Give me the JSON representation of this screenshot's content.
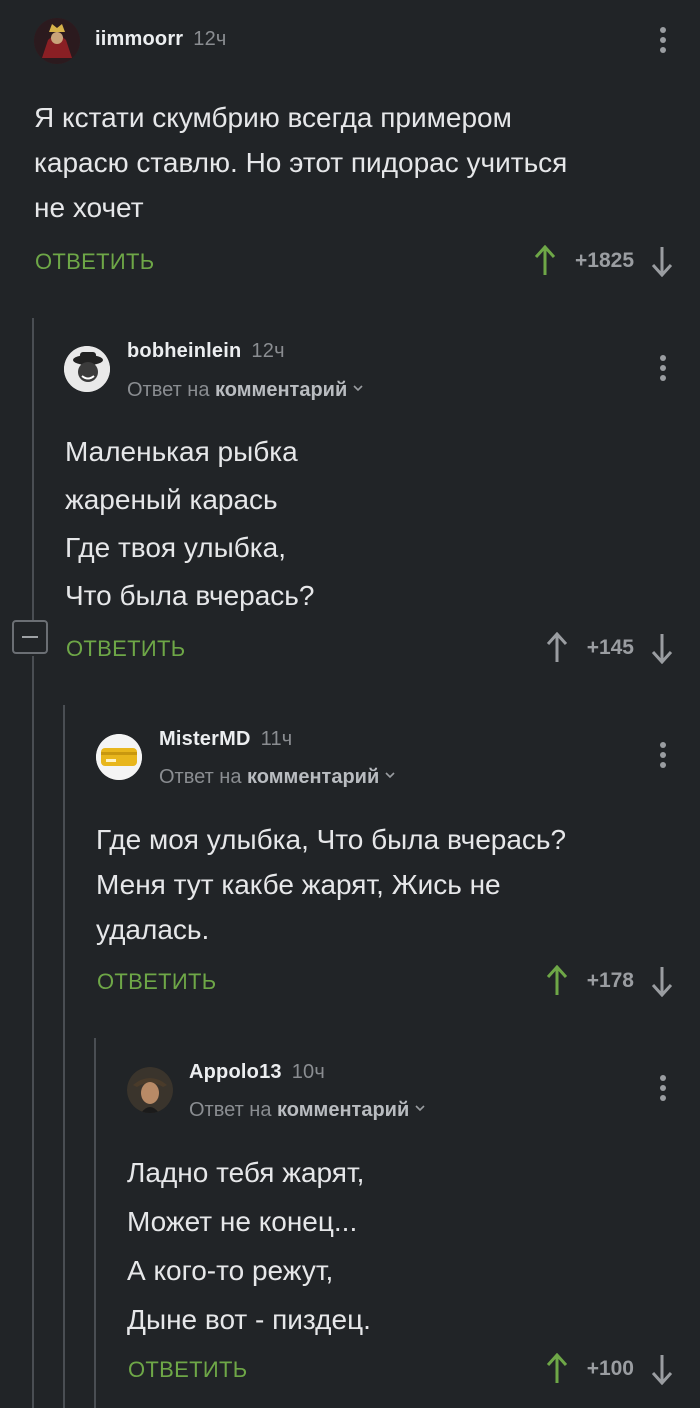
{
  "comments": [
    {
      "author": "iimmoorr",
      "time": "12ч",
      "reply_to": null,
      "lines": [
        "Я кстати скумбрию всегда примером",
        "карасю ставлю. Но этот пидорас учиться",
        "не хочет"
      ],
      "reply_label": "ОТВЕТИТЬ",
      "score": "+1825"
    },
    {
      "author": "bobheinlein",
      "time": "12ч",
      "reply_to": {
        "prefix": "Ответ на",
        "target": "комментарий"
      },
      "lines": [
        "Маленькая рыбка",
        "жареный карась",
        "Где твоя улыбка,",
        "Что была вчерась?"
      ],
      "reply_label": "ОТВЕТИТЬ",
      "score": "+145"
    },
    {
      "author": "MisterMD",
      "time": "11ч",
      "reply_to": {
        "prefix": "Ответ на",
        "target": "комментарий"
      },
      "lines": [
        "Где моя улыбка, Что была вчерась?",
        "Меня тут какбе жарят, Жись не",
        "удалась."
      ],
      "reply_label": "ОТВЕТИТЬ",
      "score": "+178"
    },
    {
      "author": "Appolo13",
      "time": "10ч",
      "reply_to": {
        "prefix": "Ответ на",
        "target": "комментарий"
      },
      "lines": [
        "Ладно тебя жарят,",
        "Может не конец...",
        "А кого-то режут,",
        "Дыне вот - пиздец."
      ],
      "reply_label": "ОТВЕТИТЬ",
      "score": "+100"
    }
  ],
  "colors": {
    "background": "#212427",
    "accent_green": "#6ea747",
    "muted": "#8a8d91",
    "thread_line": "#4a4e53"
  },
  "icons": [
    "kebab-menu-icon",
    "upvote-arrow-icon",
    "downvote-arrow-icon",
    "chevron-down-icon",
    "collapse-minus-icon"
  ]
}
